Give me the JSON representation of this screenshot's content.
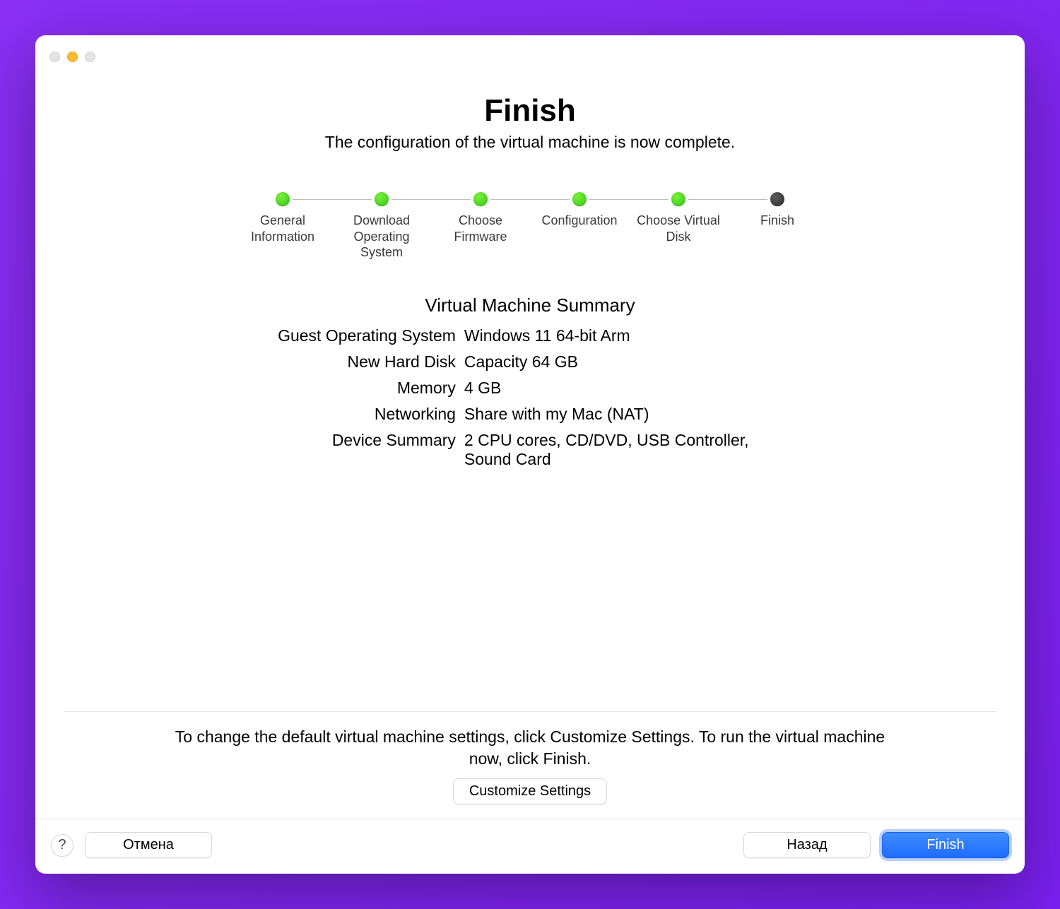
{
  "header": {
    "title": "Finish",
    "subtitle": "The configuration of the virtual machine is now complete."
  },
  "steps": [
    {
      "label": "General Information",
      "state": "done"
    },
    {
      "label": "Download Operating System",
      "state": "done"
    },
    {
      "label": "Choose Firmware",
      "state": "done"
    },
    {
      "label": "Configuration",
      "state": "done"
    },
    {
      "label": "Choose Virtual Disk",
      "state": "done"
    },
    {
      "label": "Finish",
      "state": "current"
    }
  ],
  "summary": {
    "title": "Virtual Machine Summary",
    "rows": [
      {
        "label": "Guest Operating System",
        "value": "Windows 11 64-bit Arm"
      },
      {
        "label": "New Hard Disk",
        "value": "Capacity 64 GB"
      },
      {
        "label": "Memory",
        "value": "4 GB"
      },
      {
        "label": "Networking",
        "value": "Share with my Mac (NAT)"
      },
      {
        "label": "Device Summary",
        "value": "2 CPU cores, CD/DVD, USB Controller, Sound Card"
      }
    ]
  },
  "advice": "To change the default virtual machine settings, click Customize Settings. To run the virtual machine now, click Finish.",
  "buttons": {
    "customize": "Customize Settings",
    "help": "?",
    "cancel": "Отмена",
    "back": "Назад",
    "finish": "Finish"
  }
}
